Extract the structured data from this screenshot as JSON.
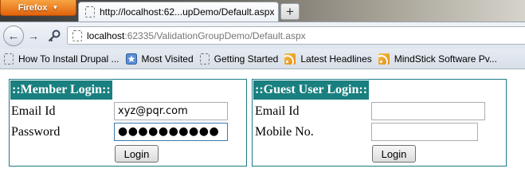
{
  "browser": {
    "app_button": "Firefox",
    "tab_title": "http://localhost:62...upDemo/Default.aspx",
    "newtab_label": "+",
    "url_host": "localhost",
    "url_rest": ":62335/ValidationGroupDemo/Default.aspx",
    "bookmarks": [
      {
        "label": "How To Install Drupal ...",
        "icon": "page-icon"
      },
      {
        "label": "Most Visited",
        "icon": "star-icon"
      },
      {
        "label": "Getting Started",
        "icon": "page-icon"
      },
      {
        "label": "Latest Headlines",
        "icon": "rss-icon"
      },
      {
        "label": "MindStick Software Pv...",
        "icon": "rss-icon"
      }
    ]
  },
  "member_login": {
    "header": "::Member Login::",
    "email_label": "Email Id",
    "email_value": "xyz@pqr.com",
    "password_label": "Password",
    "password_value": "●●●●●●●●●●",
    "button": "Login"
  },
  "guest_login": {
    "header": "::Guest User Login::",
    "email_label": "Email Id",
    "email_value": "",
    "mobile_label": "Mobile No.",
    "mobile_value": "",
    "button": "Login"
  },
  "colors": {
    "panel_header_bg": "#1a7f7f",
    "panel_border": "#1d7c84",
    "firefox_button": "#e2640c"
  }
}
